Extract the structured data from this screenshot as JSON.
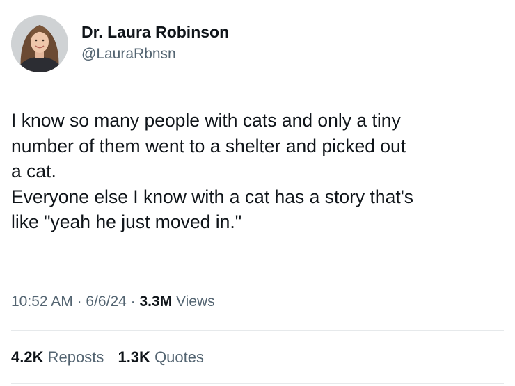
{
  "author": {
    "display_name": "Dr. Laura Robinson",
    "handle": "@LauraRbnsn",
    "avatar_icon": "profile-photo-woman"
  },
  "tweet": {
    "lines": [
      "I know so many people with cats and only a tiny",
      "number of them went to a shelter and picked out",
      "a cat.",
      "Everyone else I know with a cat has a story that's",
      "like \"yeah he just moved in.\""
    ]
  },
  "meta": {
    "time": "10:52 AM",
    "separator": "·",
    "date": "6/6/24",
    "views_count": "3.3M",
    "views_label": "Views"
  },
  "stats": {
    "reposts_count": "4.2K",
    "reposts_label": "Reposts",
    "quotes_count": "1.3K",
    "quotes_label": "Quotes"
  },
  "colors": {
    "text_primary": "#0f1419",
    "text_secondary": "#536471",
    "divider": "#e6e9eb"
  }
}
